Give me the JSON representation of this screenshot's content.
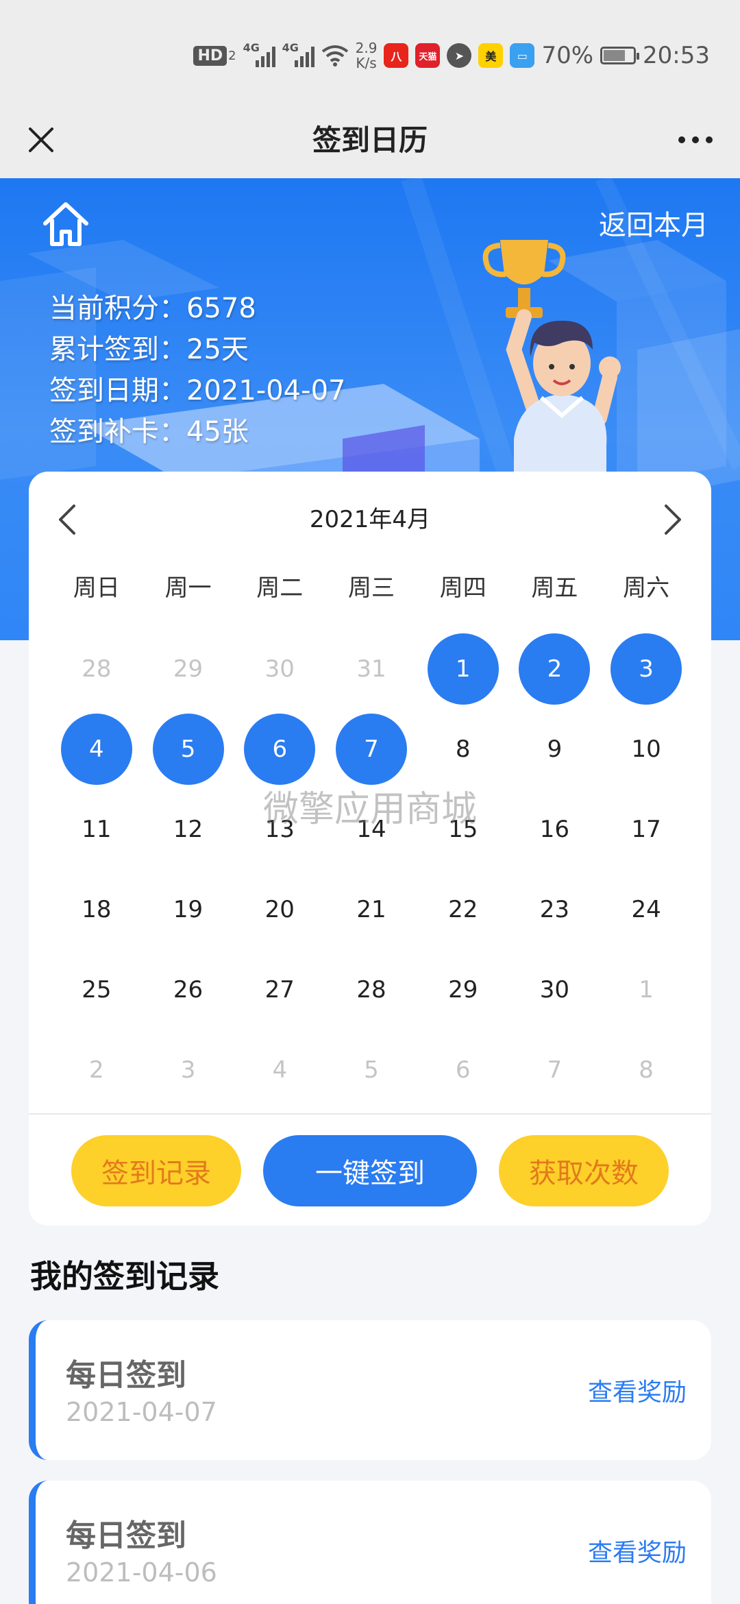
{
  "status_bar": {
    "hd_label": "HD",
    "hd_sub": "2",
    "sig1_label": "4G",
    "sig2_label": "4G",
    "net_speed_value": "2.9",
    "net_speed_unit": "K/s",
    "app1": "八",
    "app2": "天猫",
    "app4": "美",
    "battery": "70%",
    "time": "20:53"
  },
  "nav": {
    "title": "签到日历"
  },
  "banner": {
    "back_to_month": "返回本月",
    "stats": [
      {
        "label": "当前积分：",
        "value": "6578"
      },
      {
        "label": "累计签到：",
        "value": "25天"
      },
      {
        "label": "签到日期：",
        "value": "2021-04-07"
      },
      {
        "label": "签到补卡：",
        "value": "45张"
      }
    ]
  },
  "calendar": {
    "title": "2021年4月",
    "weekdays": [
      "周日",
      "周一",
      "周二",
      "周三",
      "周四",
      "周五",
      "周六"
    ],
    "days": [
      {
        "d": "28",
        "other": true,
        "signed": false
      },
      {
        "d": "29",
        "other": true,
        "signed": false
      },
      {
        "d": "30",
        "other": true,
        "signed": false
      },
      {
        "d": "31",
        "other": true,
        "signed": false
      },
      {
        "d": "1",
        "other": false,
        "signed": true
      },
      {
        "d": "2",
        "other": false,
        "signed": true
      },
      {
        "d": "3",
        "other": false,
        "signed": true
      },
      {
        "d": "4",
        "other": false,
        "signed": true
      },
      {
        "d": "5",
        "other": false,
        "signed": true
      },
      {
        "d": "6",
        "other": false,
        "signed": true
      },
      {
        "d": "7",
        "other": false,
        "signed": true
      },
      {
        "d": "8",
        "other": false,
        "signed": false
      },
      {
        "d": "9",
        "other": false,
        "signed": false
      },
      {
        "d": "10",
        "other": false,
        "signed": false
      },
      {
        "d": "11",
        "other": false,
        "signed": false
      },
      {
        "d": "12",
        "other": false,
        "signed": false
      },
      {
        "d": "13",
        "other": false,
        "signed": false
      },
      {
        "d": "14",
        "other": false,
        "signed": false
      },
      {
        "d": "15",
        "other": false,
        "signed": false
      },
      {
        "d": "16",
        "other": false,
        "signed": false
      },
      {
        "d": "17",
        "other": false,
        "signed": false
      },
      {
        "d": "18",
        "other": false,
        "signed": false
      },
      {
        "d": "19",
        "other": false,
        "signed": false
      },
      {
        "d": "20",
        "other": false,
        "signed": false
      },
      {
        "d": "21",
        "other": false,
        "signed": false
      },
      {
        "d": "22",
        "other": false,
        "signed": false
      },
      {
        "d": "23",
        "other": false,
        "signed": false
      },
      {
        "d": "24",
        "other": false,
        "signed": false
      },
      {
        "d": "25",
        "other": false,
        "signed": false
      },
      {
        "d": "26",
        "other": false,
        "signed": false
      },
      {
        "d": "27",
        "other": false,
        "signed": false
      },
      {
        "d": "28",
        "other": false,
        "signed": false
      },
      {
        "d": "29",
        "other": false,
        "signed": false
      },
      {
        "d": "30",
        "other": false,
        "signed": false
      },
      {
        "d": "1",
        "other": true,
        "signed": false
      },
      {
        "d": "2",
        "other": true,
        "signed": false
      },
      {
        "d": "3",
        "other": true,
        "signed": false
      },
      {
        "d": "4",
        "other": true,
        "signed": false
      },
      {
        "d": "5",
        "other": true,
        "signed": false
      },
      {
        "d": "6",
        "other": true,
        "signed": false
      },
      {
        "d": "7",
        "other": true,
        "signed": false
      },
      {
        "d": "8",
        "other": true,
        "signed": false
      }
    ],
    "watermark": "微擎应用商城"
  },
  "actions": {
    "records_btn": "签到记录",
    "sign_btn": "一键签到",
    "get_count_btn": "获取次数"
  },
  "records": {
    "title": "我的签到记录",
    "items": [
      {
        "name": "每日签到",
        "date": "2021-04-07",
        "link": "查看奖励"
      },
      {
        "name": "每日签到",
        "date": "2021-04-06",
        "link": "查看奖励"
      }
    ]
  },
  "colors": {
    "primary_blue": "#2a7cf1",
    "banner_blue": "#1e78f2",
    "yellow": "#fdd02a",
    "orange_text": "#e27a1c"
  }
}
